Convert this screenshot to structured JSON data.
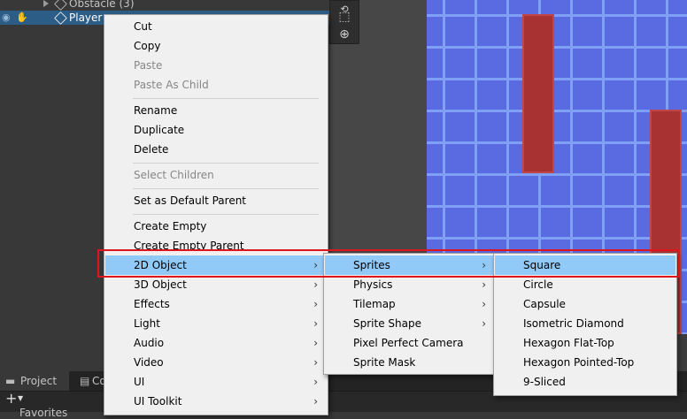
{
  "hierarchy": {
    "obstacle_label": "Obstacle (3)",
    "player_label": "Player"
  },
  "bottom_panel": {
    "project_tab": "Project",
    "console_tab": "Co",
    "add_button": "+",
    "partial_label": "Favorites"
  },
  "context_menu": {
    "items": {
      "cut": "Cut",
      "copy": "Copy",
      "paste": "Paste",
      "paste_as_child": "Paste As Child",
      "rename": "Rename",
      "duplicate": "Duplicate",
      "delete": "Delete",
      "select_children": "Select Children",
      "set_default_parent": "Set as Default Parent",
      "create_empty": "Create Empty",
      "create_empty_parent": "Create Empty Parent",
      "object_2d": "2D Object",
      "object_3d": "3D Object",
      "effects": "Effects",
      "light": "Light",
      "audio": "Audio",
      "video": "Video",
      "ui": "UI",
      "ui_toolkit": "UI Toolkit"
    }
  },
  "submenu_2d": {
    "sprites": "Sprites",
    "physics": "Physics",
    "tilemap": "Tilemap",
    "sprite_shape": "Sprite Shape",
    "pixel_perfect_camera": "Pixel Perfect Camera",
    "sprite_mask": "Sprite Mask"
  },
  "submenu_sprites": {
    "square": "Square",
    "circle": "Circle",
    "capsule": "Capsule",
    "isometric_diamond": "Isometric Diamond",
    "hexagon_flat_top": "Hexagon Flat-Top",
    "hexagon_pointed_top": "Hexagon Pointed-Top",
    "nine_sliced": "9-Sliced"
  },
  "submenu_arrow": "›",
  "colors": {
    "highlight": "#91c9f7",
    "menu_bg": "#f0f0f0",
    "selection_box": "#e0151c",
    "grid_blue": "#5a6ae0",
    "wall_red": "#a83232"
  }
}
